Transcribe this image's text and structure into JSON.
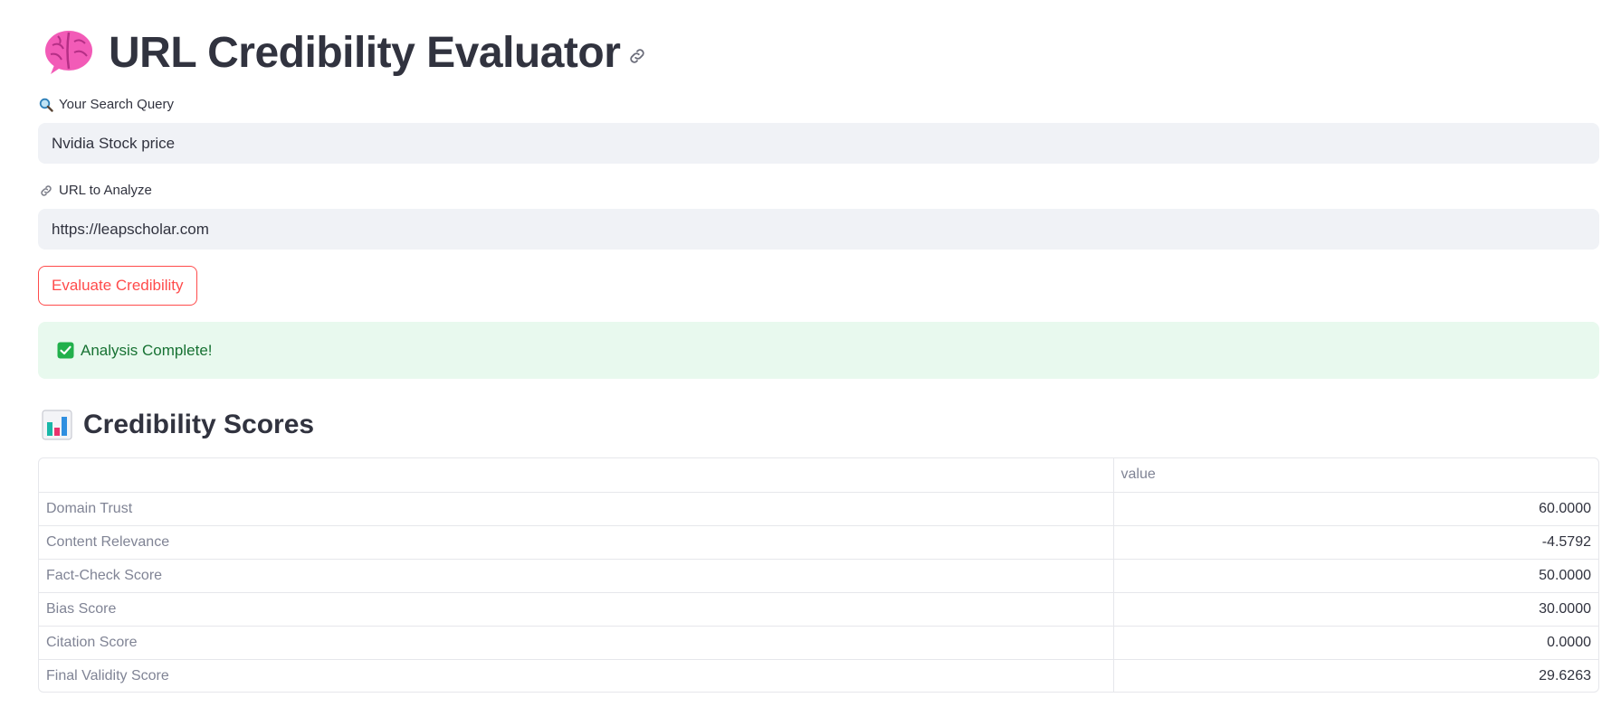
{
  "header": {
    "title": "URL Credibility Evaluator",
    "title_icon": "brain-icon",
    "anchor_icon": "link-icon"
  },
  "form": {
    "query": {
      "icon": "magnifier-icon",
      "label": "Your Search Query",
      "value": "Nvidia Stock price"
    },
    "url": {
      "icon": "link-icon",
      "label": "URL to Analyze",
      "value": "https://leapscholar.com"
    },
    "submit_label": "Evaluate Credibility"
  },
  "status": {
    "icon": "check-box-icon",
    "message": "Analysis Complete!"
  },
  "scores_section": {
    "icon": "bar-chart-icon",
    "title": "Credibility Scores",
    "table": {
      "columns": [
        "",
        "value"
      ],
      "rows": [
        {
          "label": "Domain Trust",
          "value": "60.0000"
        },
        {
          "label": "Content Relevance",
          "value": "-4.5792"
        },
        {
          "label": "Fact-Check Score",
          "value": "50.0000"
        },
        {
          "label": "Bias Score",
          "value": "30.0000"
        },
        {
          "label": "Citation Score",
          "value": "0.0000"
        },
        {
          "label": "Final Validity Score",
          "value": "29.6263"
        }
      ]
    }
  },
  "colors": {
    "accent": "#ff4b4b",
    "input_bg": "#f0f2f6",
    "success_bg": "#e8f9ee",
    "success_text": "#177233",
    "text": "#31333f",
    "muted_text": "#808495"
  }
}
